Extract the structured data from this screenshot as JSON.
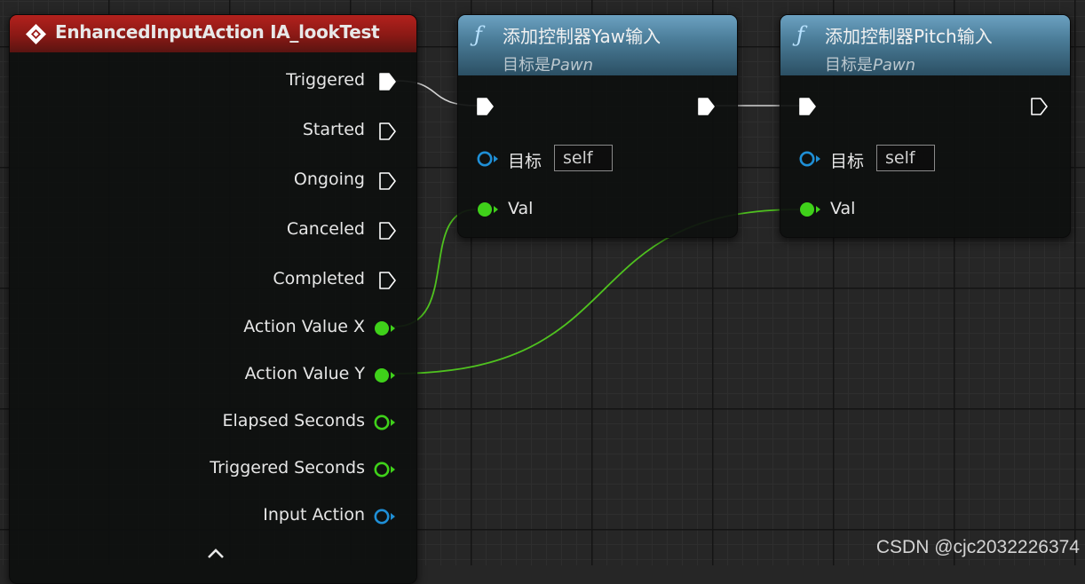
{
  "event_node": {
    "title": "EnhancedInputAction IA_lookTest",
    "header_color": "#9a1b17",
    "exec_pins": [
      {
        "label": "Triggered",
        "filled": true
      },
      {
        "label": "Started",
        "filled": false
      },
      {
        "label": "Ongoing",
        "filled": false
      },
      {
        "label": "Canceled",
        "filled": false
      },
      {
        "label": "Completed",
        "filled": false
      }
    ],
    "data_pins": [
      {
        "label": "Action Value X",
        "type": "float",
        "connected": true
      },
      {
        "label": "Action Value Y",
        "type": "float",
        "connected": true
      },
      {
        "label": "Elapsed Seconds",
        "type": "float",
        "connected": false
      },
      {
        "label": "Triggered Seconds",
        "type": "float",
        "connected": false
      },
      {
        "label": "Input Action",
        "type": "object",
        "connected": false
      }
    ],
    "collapse_glyph": "^"
  },
  "yaw_node": {
    "title": "添加控制器Yaw输入",
    "subtitle_prefix": "目标是",
    "subtitle_class": "Pawn",
    "target_label": "目标",
    "target_value": "self",
    "val_label": "Val",
    "func_glyph": "ƒ"
  },
  "pitch_node": {
    "title": "添加控制器Pitch输入",
    "subtitle_prefix": "目标是",
    "subtitle_class": "Pawn",
    "target_label": "目标",
    "target_value": "self",
    "val_label": "Val",
    "func_glyph": "ƒ"
  },
  "colors": {
    "float_pin": "#3fd11a",
    "object_pin": "#1f8fd6",
    "exec_pin": "#ffffff",
    "exec_wire": "#d8d8d8",
    "float_wire": "#4fc21f"
  },
  "watermark": "CSDN @cjc2032226374"
}
